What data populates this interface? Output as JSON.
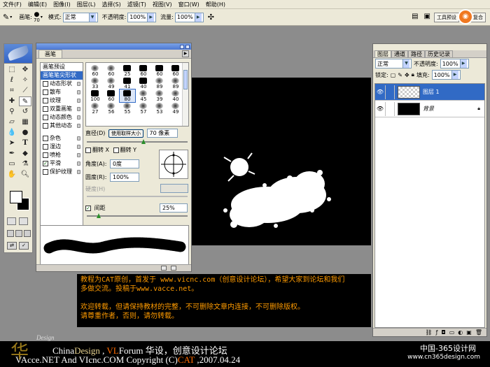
{
  "menu": [
    "文件(F)",
    "编辑(E)",
    "图像(I)",
    "图层(L)",
    "选择(S)",
    "滤镜(T)",
    "视图(V)",
    "窗口(W)",
    "帮助(H)"
  ],
  "options": {
    "brush_label": "画笔:",
    "brush_size": "70",
    "mode_label": "模式:",
    "mode_value": "正常",
    "opacity_label": "不透明度:",
    "opacity_value": "100%",
    "flow_label": "流量:",
    "flow_value": "100%",
    "tool_presets": "工具预设",
    "layer_comps": "图层复合"
  },
  "brushes": {
    "tab": "画笔",
    "header": "画笔预设",
    "tip_shape": "画笔笔尖形状",
    "options": [
      {
        "label": "动态形状",
        "checked": false
      },
      {
        "label": "散布",
        "checked": false
      },
      {
        "label": "纹理",
        "checked": false
      },
      {
        "label": "双重画笔",
        "checked": false
      },
      {
        "label": "动态颜色",
        "checked": false
      },
      {
        "label": "其他动态",
        "checked": false
      },
      {
        "label": "杂色",
        "checked": false
      },
      {
        "label": "湿边",
        "checked": false
      },
      {
        "label": "喷枪",
        "checked": false
      },
      {
        "label": "平滑",
        "checked": true
      },
      {
        "label": "保护纹理",
        "checked": false
      }
    ],
    "presets": [
      {
        "size": "60",
        "kind": "soft"
      },
      {
        "size": "60",
        "kind": "soft"
      },
      {
        "size": "25",
        "kind": "hard"
      },
      {
        "size": "60",
        "kind": "hard"
      },
      {
        "size": "60",
        "kind": "hard"
      },
      {
        "size": "60",
        "kind": "hard"
      },
      {
        "size": "33",
        "kind": "soft"
      },
      {
        "size": "49",
        "kind": "soft"
      },
      {
        "size": "41",
        "kind": "hard"
      },
      {
        "size": "40",
        "kind": "hard"
      },
      {
        "size": "89",
        "kind": "soft"
      },
      {
        "size": "89",
        "kind": "soft"
      },
      {
        "size": "100",
        "kind": "hard"
      },
      {
        "size": "60",
        "kind": "hard"
      },
      {
        "size": "80",
        "kind": "hard"
      },
      {
        "size": "45",
        "kind": "soft"
      },
      {
        "size": "39",
        "kind": "soft"
      },
      {
        "size": "40",
        "kind": "soft"
      },
      {
        "size": "27",
        "kind": "soft"
      },
      {
        "size": "56",
        "kind": "soft"
      },
      {
        "size": "55",
        "kind": "soft"
      },
      {
        "size": "57",
        "kind": "soft"
      },
      {
        "size": "53",
        "kind": "soft"
      },
      {
        "size": "49",
        "kind": "soft"
      }
    ],
    "selected_preset": 14,
    "diameter_label": "直径(D)",
    "use_sample_size": "使用取样大小",
    "diameter_value": "70 像素",
    "flip_x": "翻转 X",
    "flip_y": "翻转 Y",
    "angle_label": "角度(A):",
    "angle_value": "0度",
    "roundness_label": "圆度(R):",
    "roundness_value": "100%",
    "hardness_label": "硬度(H)",
    "spacing_label": "间距",
    "spacing_checked": true,
    "spacing_value": "25%"
  },
  "layers": {
    "tabs": [
      "图层",
      "通道",
      "路径",
      "历史记录"
    ],
    "blend_mode": "正常",
    "opacity_label": "不透明度:",
    "opacity_value": "100%",
    "lock_label": "锁定:",
    "fill_label": "填充:",
    "fill_value": "100%",
    "items": [
      {
        "name": "图层 1",
        "selected": true,
        "thumb": "transparent"
      },
      {
        "name": "背景",
        "selected": false,
        "thumb": "black"
      }
    ]
  },
  "note": {
    "line1": "教程为CAT原创，首发于 www.vicnc.com（创意设计论坛），希望大家到论坛和我们",
    "line2": "多做交流。投稿于www.vacce.net。",
    "line3": "欢迎转载，但请保持教材的完整，不可删除文章内连接，不可删除版权。",
    "line4": "请尊重作者，否则，请勿转载。"
  },
  "banner": {
    "design": "Design",
    "logo_text": "华",
    "china": "China",
    "design2": "Design",
    "sep": " , ",
    "vl": "VL",
    "forum": "Forum",
    "cn_name": "  华设，创意设计论坛",
    "line2_a": "VAcce.NET  And  VIcnc.COM  Copyright (C)",
    "cat": "CAT",
    "date": " ,2007.04.24",
    "site_cn": "中国-365设计网",
    "site_url": "www.cn365design.com"
  },
  "colors": {
    "note_text": "#ff9b00",
    "selection": "#316ac5",
    "banner_accent": "#ff6a00"
  }
}
